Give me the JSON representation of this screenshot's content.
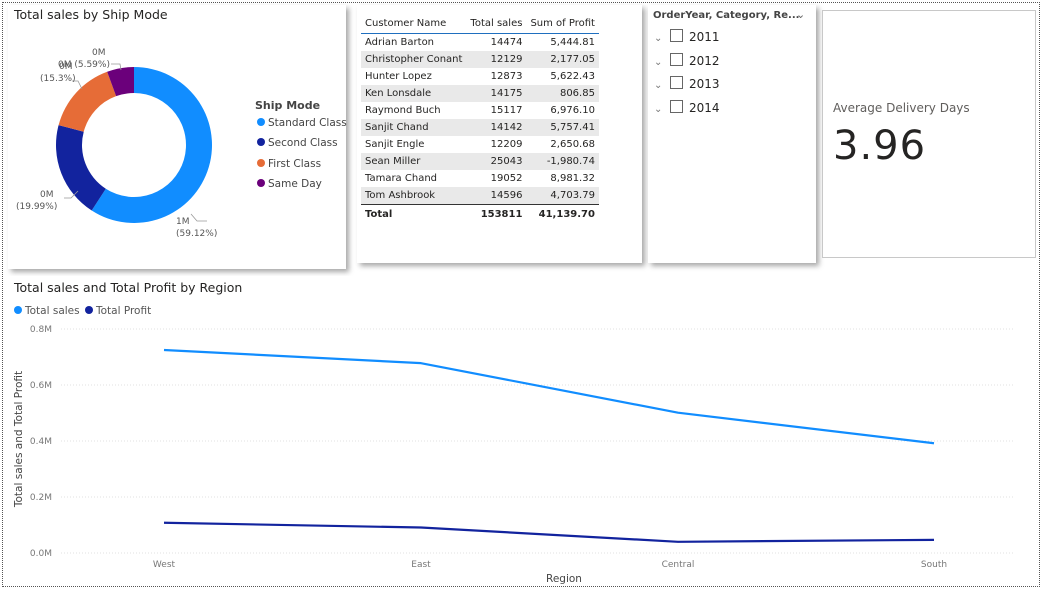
{
  "donut": {
    "title": "Total sales by Ship Mode",
    "legend_title": "Ship Mode",
    "legend": [
      {
        "label": "Standard Class",
        "color": "#118dff"
      },
      {
        "label": "Second Class",
        "color": "#12239e"
      },
      {
        "label": "First Class",
        "color": "#e66c37"
      },
      {
        "label": "Same Day",
        "color": "#6b007b"
      }
    ],
    "labels": {
      "standard": [
        "1M",
        "(59.12%)"
      ],
      "second": [
        "0M",
        "(19.99%)"
      ],
      "first": [
        "0M",
        "(15.3%)"
      ],
      "sameday": [
        "0M",
        "0M (5.59%)"
      ]
    }
  },
  "table": {
    "headers": [
      "Customer Name",
      "Total sales",
      "Sum of Profit"
    ],
    "rows": [
      [
        "Adrian Barton",
        "14474",
        "5,444.81"
      ],
      [
        "Christopher Conant",
        "12129",
        "2,177.05"
      ],
      [
        "Hunter Lopez",
        "12873",
        "5,622.43"
      ],
      [
        "Ken Lonsdale",
        "14175",
        "806.85"
      ],
      [
        "Raymond Buch",
        "15117",
        "6,976.10"
      ],
      [
        "Sanjit Chand",
        "14142",
        "5,757.41"
      ],
      [
        "Sanjit Engle",
        "12209",
        "2,650.68"
      ],
      [
        "Sean Miller",
        "25043",
        "-1,980.74"
      ],
      [
        "Tamara Chand",
        "19052",
        "8,981.32"
      ],
      [
        "Tom Ashbrook",
        "14596",
        "4,703.79"
      ]
    ],
    "total": [
      "Total",
      "153811",
      "41,139.70"
    ]
  },
  "slicer": {
    "header": "OrderYear, Category, Re...",
    "items": [
      "2011",
      "2012",
      "2013",
      "2014"
    ]
  },
  "card": {
    "label": "Average Delivery Days",
    "value": "3.96"
  },
  "line_chart": {
    "title": "Total sales and Total Profit by Region",
    "legend": [
      {
        "label": "Total sales",
        "color": "#118dff"
      },
      {
        "label": "Total Profit",
        "color": "#12239e"
      }
    ]
  },
  "chart_data": [
    {
      "type": "pie",
      "title": "Total sales by Ship Mode",
      "categories": [
        "Standard Class",
        "Second Class",
        "First Class",
        "Same Day"
      ],
      "values": [
        59.12,
        19.99,
        15.3,
        5.59
      ],
      "colors": [
        "#118dff",
        "#12239e",
        "#e66c37",
        "#6b007b"
      ],
      "legend": "right"
    },
    {
      "type": "line",
      "title": "Total sales and Total Profit by Region",
      "xlabel": "Region",
      "ylabel": "Total sales and Total Profit",
      "categories": [
        "West",
        "East",
        "Central",
        "South"
      ],
      "yticks": [
        "0.0M",
        "0.2M",
        "0.4M",
        "0.6M",
        "0.8M"
      ],
      "ylim": [
        0,
        800000
      ],
      "grid": true,
      "legend": "top-left",
      "series": [
        {
          "name": "Total sales",
          "color": "#118dff",
          "values": [
            725000,
            678000,
            501000,
            392000
          ]
        },
        {
          "name": "Total Profit",
          "color": "#12239e",
          "values": [
            108000,
            91000,
            40000,
            47000
          ]
        }
      ]
    }
  ]
}
